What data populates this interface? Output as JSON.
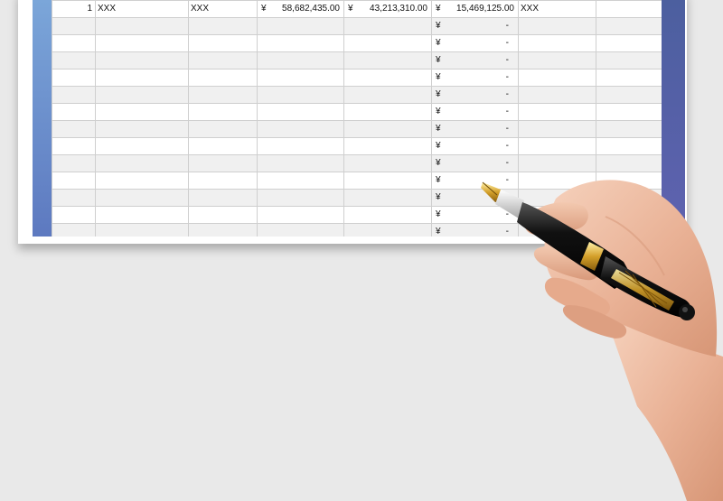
{
  "sheet": {
    "rows": [
      {
        "index": "1",
        "col_b": "XXX",
        "col_c": "XXX",
        "currency1": "¥",
        "amount1": "58,682,435.00",
        "currency2": "¥",
        "amount2": "43,213,310.00",
        "currency3": "¥",
        "amount3": "15,469,125.00",
        "col_h": "XXX"
      },
      {
        "currency3": "¥",
        "amount3": "-"
      },
      {
        "currency3": "¥",
        "amount3": "-"
      },
      {
        "currency3": "¥",
        "amount3": "-"
      },
      {
        "currency3": "¥",
        "amount3": "-"
      },
      {
        "currency3": "¥",
        "amount3": "-"
      },
      {
        "currency3": "¥",
        "amount3": "-"
      },
      {
        "currency3": "¥",
        "amount3": "-"
      },
      {
        "currency3": "¥",
        "amount3": "-"
      },
      {
        "currency3": "¥",
        "amount3": "-"
      },
      {
        "currency3": "¥",
        "amount3": "-"
      },
      {
        "currency3": "¥",
        "amount3": "-"
      },
      {
        "currency3": "¥",
        "amount3": "-"
      },
      {
        "currency3": "¥",
        "amount3": "-"
      }
    ]
  },
  "colors": {
    "background": "#e9e9e9",
    "frame_left": "#6f93d0",
    "frame_right": "#4f60a6",
    "row_alt": "#f0f0f0",
    "grid": "#cfcfcf"
  },
  "decoration": {
    "illustration": "hand-holding-fountain-pen"
  }
}
